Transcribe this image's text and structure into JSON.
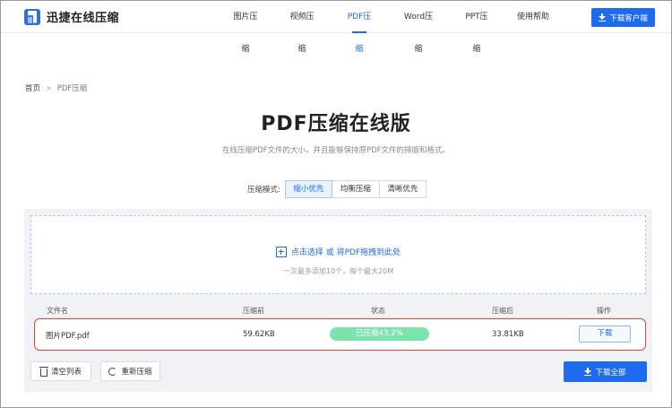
{
  "header": {
    "logo_text": "迅捷在线压缩",
    "nav": [
      {
        "label": "图片压缩"
      },
      {
        "label": "视频压缩"
      },
      {
        "label": "PDF压缩"
      },
      {
        "label": "Word压缩"
      },
      {
        "label": "PPT压缩"
      },
      {
        "label": "使用帮助"
      }
    ],
    "active_nav": "PDF压缩",
    "download_client_label": "下载客户端"
  },
  "breadcrumb": {
    "home": "首页",
    "separator": ">",
    "current": "PDF压缩"
  },
  "main": {
    "title": "PDF压缩在线版",
    "subtitle": "在线压缩PDF文件的大小，并且能够保持原PDF文件的排版和格式。"
  },
  "mode": {
    "label": "压缩模式:",
    "options": [
      {
        "label": "缩小优先"
      },
      {
        "label": "均衡压缩"
      },
      {
        "label": "清晰优先"
      }
    ],
    "selected": "缩小优先"
  },
  "dropzone": {
    "main_text": "点击选择 或 将PDF拖拽到此处",
    "hint": "一次最多添加10个，每个最大20M"
  },
  "table": {
    "columns": {
      "filename": "文件名",
      "before": "压缩前",
      "status": "状态",
      "after": "压缩后",
      "action": "操作"
    },
    "rows": [
      {
        "filename": "图片PDF.pdf",
        "before": "59.62KB",
        "status": "已压缩43.2%",
        "progress_percent": 100,
        "after": "33.81KB",
        "action": "下载"
      }
    ]
  },
  "footer_actions": {
    "clear_label": "清空列表",
    "recompress_label": "重新压缩",
    "download_all_label": "下载全部"
  },
  "colors": {
    "accent": "#1f6bf0",
    "status_green": "#7ce3ae",
    "highlight_red": "#d8483a",
    "panel_bg": "#f1f2f5"
  }
}
